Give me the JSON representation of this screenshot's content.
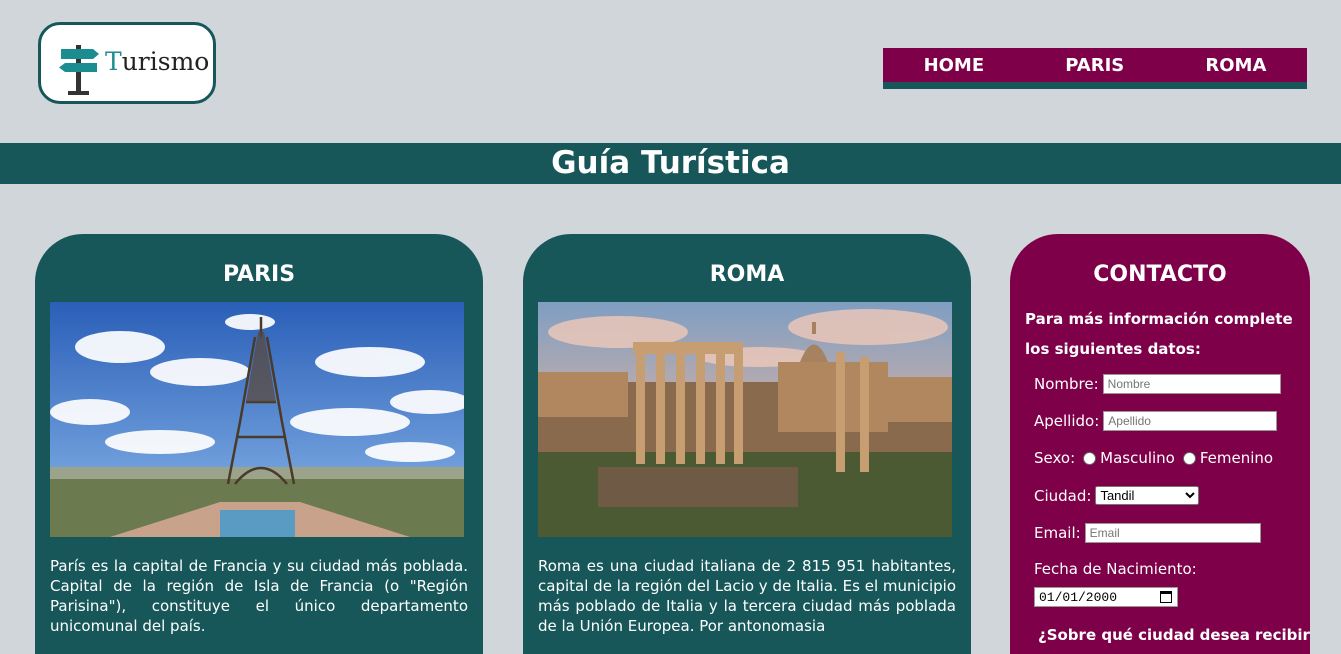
{
  "logo": {
    "first_letter": "T",
    "rest": "urismo"
  },
  "nav": {
    "items": [
      "HOME",
      "PARIS",
      "ROMA"
    ]
  },
  "banner": {
    "title": "Guía Turística"
  },
  "paris": {
    "title": "PARIS",
    "text": "París es la capital de Francia y su ciudad más poblada. Capital de la región de Isla de Francia (o \"Región Parisina\"), constituye el único departamento unicomunal del país."
  },
  "roma": {
    "title": "ROMA",
    "text": "Roma es una ciudad italiana de 2 815 951 habitantes, capital de la región del Lacio y de Italia. Es el municipio más poblado de Italia y la tercera ciudad más poblada de la Unión Europea. Por antonomasia"
  },
  "contact": {
    "title": "CONTACTO",
    "intro": "Para más información complete los siguientes datos:",
    "nombre_label": "Nombre:",
    "nombre_placeholder": "Nombre",
    "apellido_label": "Apellido:",
    "apellido_placeholder": "Apellido",
    "sexo_label": "Sexo:",
    "masculino": "Masculino",
    "femenino": "Femenino",
    "ciudad_label": "Ciudad:",
    "ciudad_value": "Tandil",
    "email_label": "Email:",
    "email_placeholder": "Email",
    "fecha_label": "Fecha de Nacimiento:",
    "fecha_value": "01/01/2000",
    "more_text": "¿Sobre qué ciudad desea recibir"
  },
  "colors": {
    "teal": "#17575a",
    "magenta": "#7d0049",
    "bg": "#d1d6db"
  }
}
